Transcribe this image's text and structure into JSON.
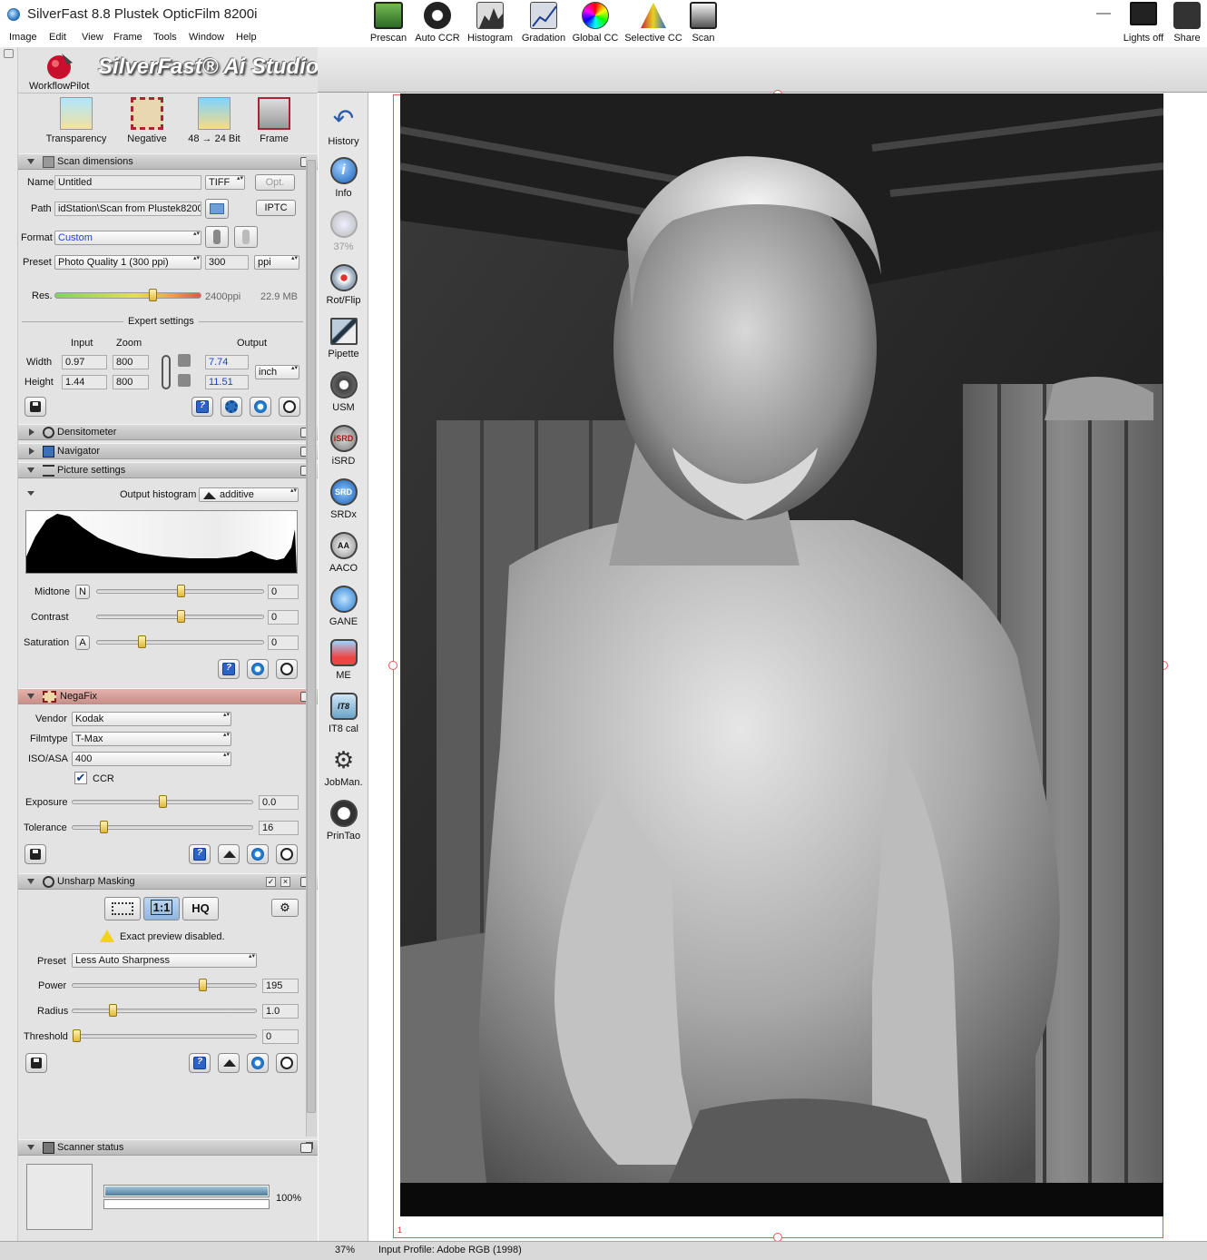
{
  "window": {
    "title": "SilverFast 8.8 Plustek OpticFilm 8200i",
    "minimize": "—",
    "maximize": "☐",
    "close": "✕"
  },
  "menu": [
    "Image",
    "Edit",
    "View",
    "Frame",
    "Tools",
    "Window",
    "Help"
  ],
  "branding": {
    "workflow_pilot": "WorkflowPilot",
    "product": "SilverFast® Ai Studio"
  },
  "mode_buttons": [
    {
      "label": "Transparency",
      "icon": "transparency-icon"
    },
    {
      "label": "Negative",
      "icon": "negafix-icon"
    },
    {
      "label": "48 → 24 Bit",
      "icon": "bitdepth-icon"
    },
    {
      "label": "Frame",
      "icon": "frame-tools-icon"
    }
  ],
  "scan_dimensions": {
    "header": "Scan dimensions",
    "name_label": "Name",
    "name_value": "Untitled",
    "format_select": "TIFF",
    "opt_button": "Opt.",
    "path_label": "Path",
    "path_value": "idStation\\Scan from Plustek8200i",
    "iptc_button": "IPTC",
    "format_label": "Format",
    "format_value": "Custom",
    "preset_label": "Preset",
    "preset_value": "Photo Quality 1 (300 ppi)",
    "ppi_value": "300",
    "ppi_unit": "ppi",
    "res_label": "Res.",
    "res_value": "2400ppi",
    "file_size": "22.9 MB",
    "res_slider_fraction": 0.67,
    "expert_settings": "Expert settings",
    "input_label": "Input",
    "zoom_label": "Zoom",
    "output_label": "Output",
    "width_label": "Width",
    "width_input": "0.97",
    "width_zoom": "800",
    "width_output": "7.74",
    "height_label": "Height",
    "height_input": "1.44",
    "height_zoom": "800",
    "height_output": "11.51",
    "unit": "inch"
  },
  "densitometer": {
    "header": "Densitometer"
  },
  "navigator": {
    "header": "Navigator"
  },
  "picture_settings": {
    "header": "Picture settings",
    "output_histogram_label": "Output histogram",
    "histogram_mode": "additive",
    "midtone_label": "Midtone",
    "midtone_btn": "N",
    "midtone_value": "0",
    "midtone_fraction": 0.5,
    "contrast_label": "Contrast",
    "contrast_value": "0",
    "contrast_fraction": 0.5,
    "saturation_label": "Saturation",
    "saturation_btn": "A",
    "saturation_value": "0",
    "saturation_fraction": 0.27
  },
  "negafix": {
    "header": "NegaFix",
    "vendor_label": "Vendor",
    "vendor_value": "Kodak",
    "filmtype_label": "Filmtype",
    "filmtype_value": "T-Max",
    "iso_label": "ISO/ASA",
    "iso_value": "400",
    "ccr_label": "CCR",
    "ccr_check": "✔",
    "exposure_label": "Exposure",
    "exposure_value": "0.0",
    "exposure_fraction": 0.5,
    "tolerance_label": "Tolerance",
    "tolerance_value": "16",
    "tolerance_fraction": 0.17
  },
  "unsharp": {
    "header": "Unsharp Masking",
    "mode_one": "1:1",
    "mode_hq": "HQ",
    "warning": "Exact preview disabled.",
    "preset_label": "Preset",
    "preset_value": "Less Auto Sharpness",
    "power_label": "Power",
    "power_value": "195",
    "power_fraction": 0.71,
    "radius_label": "Radius",
    "radius_value": "1.0",
    "radius_fraction": 0.22,
    "threshold_label": "Threshold",
    "threshold_value": "0",
    "threshold_fraction": 0.0
  },
  "scanner_status": {
    "header": "Scanner status",
    "progress": "100%",
    "progress_fraction": 1.0
  },
  "top_tools": [
    {
      "label": "Prescan",
      "icon": "prescan-icon"
    },
    {
      "label": "Auto CCR",
      "icon": "auto-ccr-icon"
    },
    {
      "label": "Histogram",
      "icon": "histogram-icon"
    },
    {
      "label": "Gradation",
      "icon": "gradation-icon"
    },
    {
      "label": "Global CC",
      "icon": "global-cc-icon"
    },
    {
      "label": "Selective CC",
      "icon": "selective-cc-icon"
    },
    {
      "label": "Scan",
      "icon": "scan-icon"
    }
  ],
  "top_right_tools": [
    {
      "label": "Lights off",
      "icon": "monitor-icon"
    },
    {
      "label": "Share",
      "icon": "share-icon"
    }
  ],
  "side_tools": [
    {
      "label": "History",
      "icon": "history-icon"
    },
    {
      "label": "Info",
      "icon": "info-icon"
    },
    {
      "label": "37%",
      "icon": "zoom-icon"
    },
    {
      "label": "Rot/Flip",
      "icon": "rotate-flip-icon"
    },
    {
      "label": "Pipette",
      "icon": "pipette-icon"
    },
    {
      "label": "USM",
      "icon": "usm-icon"
    },
    {
      "label": "iSRD",
      "icon": "isrd-icon"
    },
    {
      "label": "SRDx",
      "icon": "srdx-icon"
    },
    {
      "label": "AACO",
      "icon": "aaco-icon"
    },
    {
      "label": "GANE",
      "icon": "gane-icon"
    },
    {
      "label": "ME",
      "icon": "me-icon"
    },
    {
      "label": "IT8 cal",
      "icon": "it8-icon"
    },
    {
      "label": "JobMan.",
      "icon": "jobmanager-icon"
    },
    {
      "label": "PrinTao",
      "icon": "printao-icon"
    }
  ],
  "status_bar": {
    "zoom": "37%",
    "profile": "Input Profile: Adobe RGB (1998)"
  },
  "preview": {
    "frame_number": "1"
  }
}
